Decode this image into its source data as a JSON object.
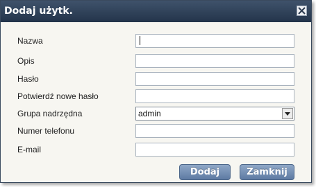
{
  "dialog": {
    "title": "Dodaj użytk.",
    "close_icon": "close-x-icon"
  },
  "form": {
    "fields": [
      {
        "label": "Nazwa",
        "value": ""
      },
      {
        "label": "Opis",
        "value": ""
      },
      {
        "label": "Hasło",
        "value": ""
      },
      {
        "label": "Potwierdź nowe hasło",
        "value": ""
      },
      {
        "label": "Grupa nadrzędna",
        "value": "admin"
      },
      {
        "label": "Numer telefonu",
        "value": ""
      },
      {
        "label": "E-mail",
        "value": ""
      }
    ]
  },
  "buttons": {
    "add_label": "Dodaj",
    "close_label": "Zamknij"
  },
  "colors": {
    "titlebar": "#2c3d55",
    "button": "#6f8ab0",
    "dialog_bg": "#f7f6f1"
  }
}
